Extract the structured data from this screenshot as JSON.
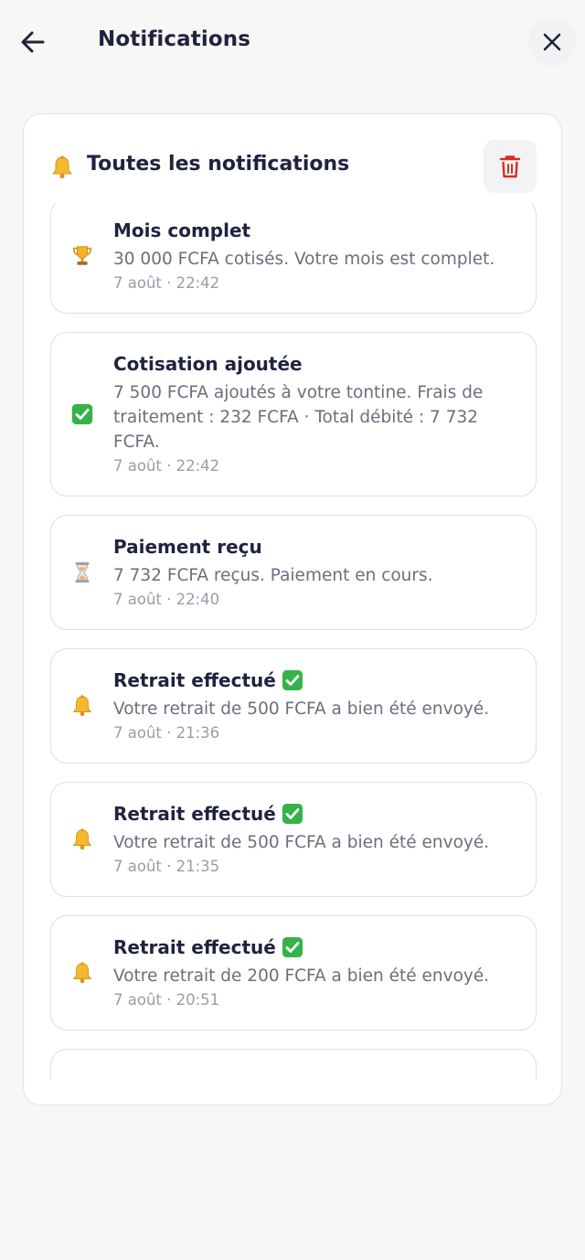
{
  "header": {
    "title": "Notifications",
    "back_icon": "arrow-left-icon",
    "close_icon": "close-icon"
  },
  "panel": {
    "title": "Toutes les notifications",
    "title_icon": "bell-icon",
    "delete_icon": "trash-icon"
  },
  "colors": {
    "background": "#f8f7f5",
    "text_primary": "#1f2340",
    "text_secondary": "#6b6e7e",
    "trash_red": "#d92d20",
    "success_green": "#35b34a"
  },
  "notifications": [
    {
      "icon": "trophy-icon",
      "title": "Mois complet",
      "badge": false,
      "body": "30 000 FCFA cotisés. Votre mois est complet.",
      "time": "7 août · 22:42"
    },
    {
      "icon": "check-icon",
      "title": "Cotisation ajoutée",
      "badge": false,
      "body": "7 500 FCFA ajoutés à votre tontine. Frais de traitement : 232 FCFA · Total débité : 7 732 FCFA.",
      "time": "7 août · 22:42"
    },
    {
      "icon": "hourglass-icon",
      "title": "Paiement reçu",
      "badge": false,
      "body": "7 732 FCFA reçus. Paiement en cours.",
      "time": "7 août · 22:40"
    },
    {
      "icon": "bell-icon",
      "title": "Retrait effectué",
      "badge": true,
      "body": "Votre retrait de 500 FCFA a bien été envoyé.",
      "time": "7 août · 21:36"
    },
    {
      "icon": "bell-icon",
      "title": "Retrait effectué",
      "badge": true,
      "body": "Votre retrait de 500 FCFA a bien été envoyé.",
      "time": "7 août · 21:35"
    },
    {
      "icon": "bell-icon",
      "title": "Retrait effectué",
      "badge": true,
      "body": "Votre retrait de 200 FCFA a bien été envoyé.",
      "time": "7 août · 20:51"
    }
  ]
}
